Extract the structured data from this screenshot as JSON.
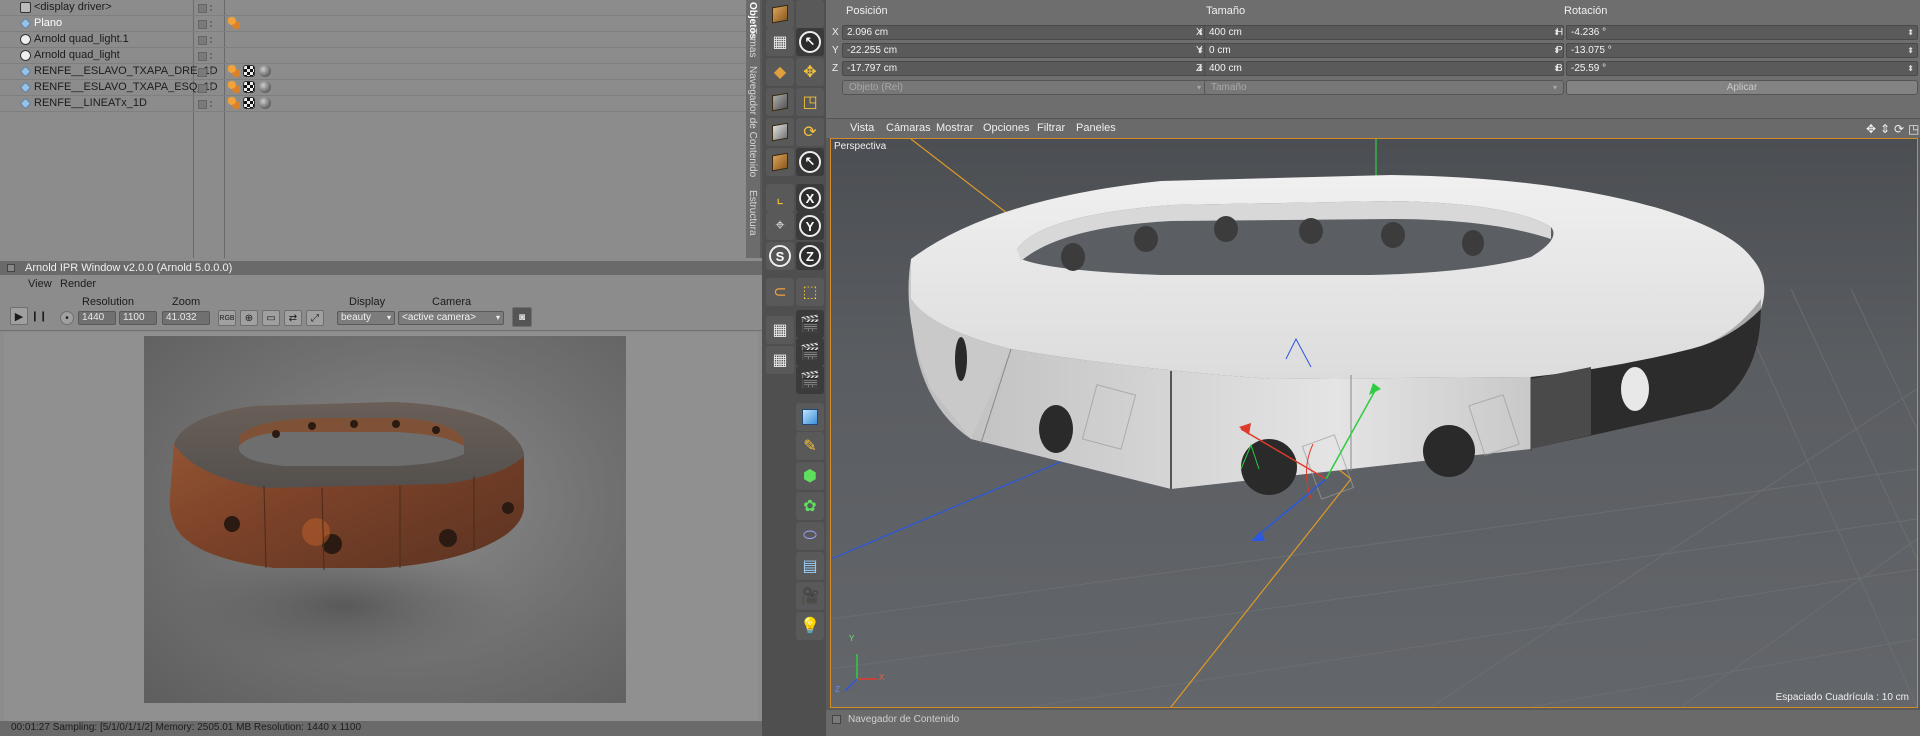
{
  "object_manager": {
    "rows": [
      {
        "label": "<display driver>",
        "icon": "display-driver-icon"
      },
      {
        "label": "Plano",
        "icon": "plane-icon",
        "selected": true
      },
      {
        "label": "Arnold quad_light.1",
        "icon": "light-icon"
      },
      {
        "label": "Arnold quad_light",
        "icon": "light-icon"
      },
      {
        "label": "RENFE__ESLAVO_TXAPA_DRE_1D",
        "icon": "polygon-icon"
      },
      {
        "label": "RENFE__ESLAVO_TXAPA_ESQ_1D",
        "icon": "polygon-icon"
      },
      {
        "label": "RENFE__LINEATx_1D",
        "icon": "polygon-icon"
      }
    ]
  },
  "side_tabs": [
    "Objetos",
    "Tomas",
    "Navegador de Contenido",
    "Estructura"
  ],
  "ipr": {
    "title": "Arnold IPR Window v2.0.0 (Arnold 5.0.0.0)",
    "menu": [
      "View",
      "Render"
    ],
    "resolution_label": "Resolution",
    "zoom_label": "Zoom",
    "display_label": "Display",
    "camera_label": "Camera",
    "res_w": "1440",
    "res_h": "1100",
    "zoom": "41.032",
    "rgb": "RGB",
    "display_value": "beauty",
    "camera_value": "<active camera>",
    "status": "00:01:27  Sampling: [5/1/0/1/1/2]  Memory: 2505.01 MB  Resolution: 1440 x 1100"
  },
  "attributes": {
    "headers": {
      "position": "Posición",
      "size": "Tamaño",
      "rotation": "Rotación"
    },
    "position": [
      {
        "axis": "X",
        "value": "2.096 cm"
      },
      {
        "axis": "Y",
        "value": "-22.255 cm"
      },
      {
        "axis": "Z",
        "value": "-17.797 cm"
      }
    ],
    "size": [
      {
        "axis": "X",
        "value": "400 cm"
      },
      {
        "axis": "Y",
        "value": "0 cm"
      },
      {
        "axis": "Z",
        "value": "400 cm"
      }
    ],
    "rotation": [
      {
        "axis": "H",
        "value": "-4.236 °"
      },
      {
        "axis": "P",
        "value": "-13.075 °"
      },
      {
        "axis": "B",
        "value": "-25.59 °"
      }
    ],
    "mode_dropdown": "Objeto (Rel)",
    "size_dropdown": "Tamaño",
    "apply_label": "Aplicar"
  },
  "viewport": {
    "menu": [
      "Vista",
      "Cámaras",
      "Mostrar",
      "Opciones",
      "Filtrar",
      "Paneles"
    ],
    "camera_name": "Perspectiva",
    "grid_spacing": "Espaciado Cuadrícula : 10 cm",
    "axis_x_label": "X",
    "axis_y_label": "Y",
    "axis_z_label": "Z"
  },
  "content_browser": {
    "label": "Navegador de Contenido"
  },
  "colors": {
    "accent": "#d38b26",
    "axis_x": "#e03a2a",
    "axis_y": "#2ecc40",
    "axis_z": "#2a58e0"
  }
}
